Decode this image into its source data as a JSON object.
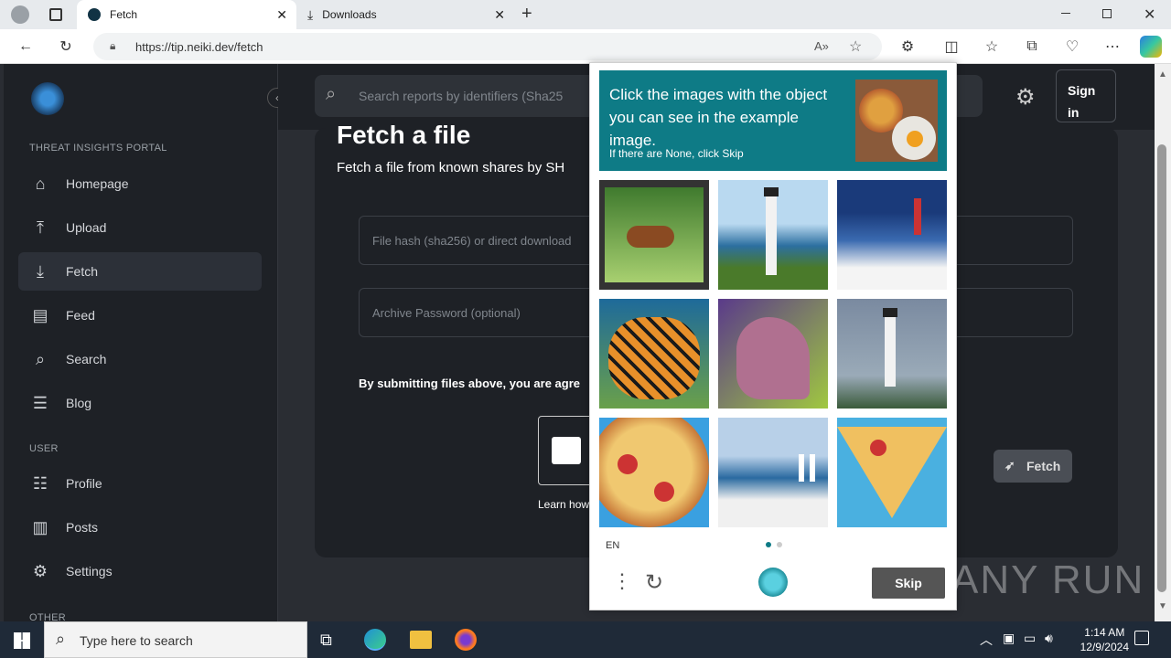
{
  "browser": {
    "tabs": [
      {
        "title": "Fetch",
        "active": true
      },
      {
        "title": "Downloads",
        "active": false
      }
    ],
    "url": "https://tip.neiki.dev/fetch"
  },
  "sidebar": {
    "section_portal": "THREAT INSIGHTS PORTAL",
    "items_main": [
      {
        "label": "Homepage",
        "icon": "home-icon"
      },
      {
        "label": "Upload",
        "icon": "upload-icon"
      },
      {
        "label": "Fetch",
        "icon": "download-icon",
        "active": true
      },
      {
        "label": "Feed",
        "icon": "feed-icon"
      },
      {
        "label": "Search",
        "icon": "search-icon"
      },
      {
        "label": "Blog",
        "icon": "blog-icon"
      }
    ],
    "section_user": "USER",
    "items_user": [
      {
        "label": "Profile",
        "icon": "profile-icon"
      },
      {
        "label": "Posts",
        "icon": "posts-icon"
      },
      {
        "label": "Settings",
        "icon": "gear-icon"
      }
    ],
    "section_other": "OTHER"
  },
  "topbar": {
    "search_placeholder": "Search reports by identifiers (Sha25",
    "signin_label": "Sign in"
  },
  "main": {
    "title": "Fetch a file",
    "subtitle": "Fetch a file from known shares by SH",
    "hash_placeholder": "File hash (sha256) or direct download",
    "password_placeholder": "Archive Password (optional)",
    "terms_text": "By submitting files above, you are agre",
    "learn_text": "Learn how",
    "fetch_button": "Fetch"
  },
  "captcha": {
    "instruction": "Click the images with the object you can see in the example image.",
    "hint": "If there are None, click Skip",
    "language": "EN",
    "skip_label": "Skip",
    "tiles": [
      "horse painting",
      "lighthouse cliff",
      "lighthouse snow",
      "tiger",
      "horse head",
      "lighthouse",
      "pizza",
      "lighthouses shore",
      "pizza slice"
    ]
  },
  "taskbar": {
    "search_placeholder": "Type here to search",
    "time": "1:14 AM",
    "date": "12/9/2024"
  },
  "watermark": "ANY RUN",
  "colors": {
    "teal": "#0e7b86",
    "sidebar_bg": "#1e2126",
    "page_bg": "#2a2d33"
  }
}
